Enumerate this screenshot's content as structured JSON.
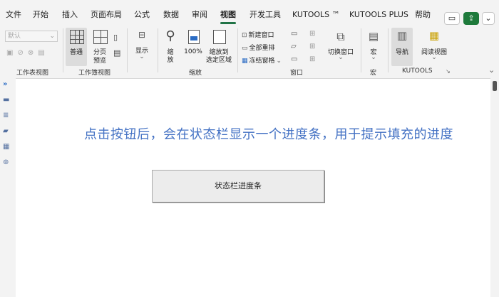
{
  "menu": {
    "items": [
      "文件",
      "开始",
      "插入",
      "页面布局",
      "公式",
      "数据",
      "审阅",
      "视图",
      "开发工具",
      "KUTOOLS ™",
      "KUTOOLS PLUS",
      "帮助"
    ],
    "active": "视图"
  },
  "ribbon": {
    "workbook_views": {
      "dropdown_value": "默认",
      "group_label": "工作表视图"
    },
    "workbook_group": {
      "normal": "普通",
      "page_break_1": "分页",
      "page_break_2": "预览",
      "group_label": "工作簿视图"
    },
    "show": {
      "label": "显示"
    },
    "zoom": {
      "zoom_1": "缩",
      "zoom_2": "放",
      "zoom100": "100%",
      "zoom_sel_1": "缩放到",
      "zoom_sel_2": "选定区域",
      "group_label": "缩放"
    },
    "window": {
      "new_window": "新建窗口",
      "arrange_all": "全部重排",
      "freeze_panes": "冻结窗格",
      "switch_windows": "切换窗口",
      "group_label": "窗口"
    },
    "macros": {
      "label": "宏",
      "group_label": "宏"
    },
    "kutools": {
      "nav": "导航",
      "reading_view": "阅读视图",
      "group_label": "KUTOOLS"
    }
  },
  "sheet": {
    "message": "点击按钮后，会在状态栏显示一个进度条，用于提示填充的进度",
    "button_label": "状态栏进度条"
  },
  "colors": {
    "accent": "#217346",
    "message": "#4472c4"
  }
}
